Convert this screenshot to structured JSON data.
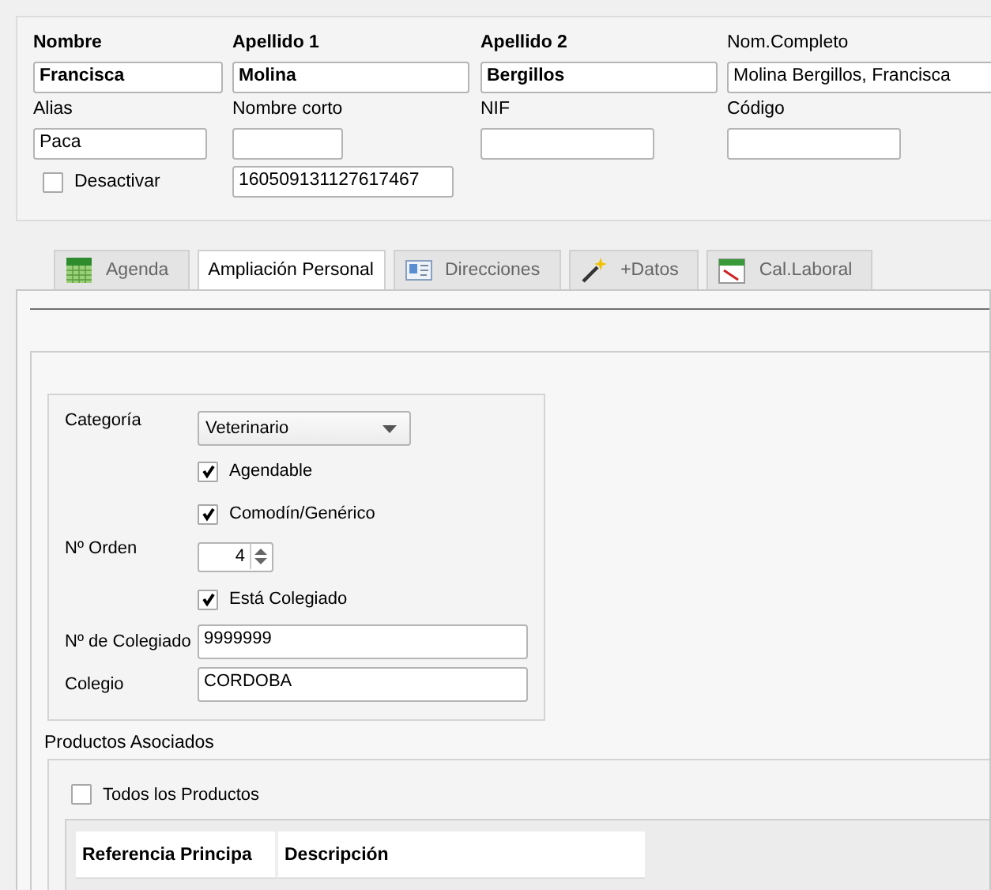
{
  "header_form": {
    "rows": [
      {
        "kind": "labeled",
        "fields": [
          {
            "label": "Nombre",
            "value": "Francisca",
            "kind": "primary"
          },
          {
            "label": "Apellido 1",
            "value": "Molina",
            "kind": "primary"
          },
          {
            "label": "Apellido 2",
            "value": "Bergillos",
            "kind": "primary"
          },
          {
            "label": "Nom.Completo",
            "value": "Molina Bergillos, Francisca",
            "kind": "plain"
          }
        ]
      },
      {
        "kind": "labeled",
        "fields": [
          {
            "label": "Alias",
            "value": "Paca",
            "kind": "plain"
          },
          {
            "label": "Nombre corto",
            "kind": "plain"
          },
          {
            "label": "NIF",
            "kind": "plain"
          },
          {
            "label": "Código",
            "kind": "plain"
          }
        ]
      }
    ],
    "deactivate": {
      "label": "Desactivar",
      "checked": false
    },
    "code_value": "160509131127617467"
  },
  "tabs": [
    {
      "label": "Agenda",
      "selected": false
    },
    {
      "label": "Ampliación Personal",
      "selected": true
    },
    {
      "label": "Direcciones",
      "selected": false
    },
    {
      "label": "+Datos",
      "selected": false
    },
    {
      "label": "Cal.Laboral",
      "selected": false
    }
  ],
  "details": {
    "rows": [
      {
        "kind": "select",
        "label": "Categoría",
        "value": "Veterinario"
      },
      {
        "kind": "checkbox",
        "label": "Agendable",
        "checked": true
      },
      {
        "kind": "checkbox",
        "label": "Comodín/Genérico",
        "checked": true
      },
      {
        "kind": "spin",
        "label": "Nº Orden",
        "value": "4"
      },
      {
        "kind": "checkbox",
        "label": "Está Colegiado",
        "checked": true
      },
      {
        "kind": "text",
        "label": "Nº de Colegiado",
        "value": "9999999"
      },
      {
        "kind": "text",
        "label": "Colegio",
        "value": "CORDOBA"
      }
    ]
  },
  "products": {
    "title": "Productos Asociados",
    "all": {
      "label": "Todos los Productos",
      "checked": false
    },
    "table": {
      "columns": [
        "Referencia Principa",
        "Descripción"
      ]
    }
  }
}
